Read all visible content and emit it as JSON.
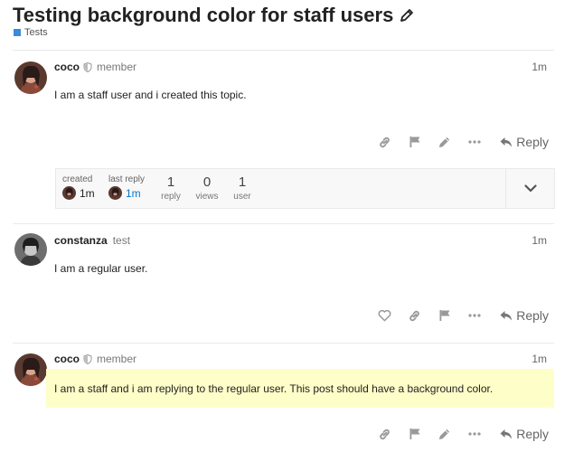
{
  "topic": {
    "title": "Testing background color for staff users",
    "category": "Tests",
    "category_color": "#3a8bd9"
  },
  "posts": [
    {
      "username": "coco",
      "user_title": "member",
      "is_staff": true,
      "date": "1m",
      "body": "I am a staff user and i created this topic.",
      "highlighted": false,
      "actions": [
        "link-icon",
        "flag-icon",
        "pencil-icon",
        "ellipsis-icon"
      ],
      "reply_label": "Reply"
    },
    {
      "username": "constanza",
      "user_title": "test",
      "is_staff": false,
      "date": "1m",
      "body": "I am a regular user.",
      "highlighted": false,
      "actions": [
        "heart-icon",
        "link-icon",
        "flag-icon",
        "ellipsis-icon"
      ],
      "reply_label": "Reply"
    },
    {
      "username": "coco",
      "user_title": "member",
      "is_staff": true,
      "date": "1m",
      "body": "I am a staff and i am replying to the regular user. This post should have a background color.",
      "highlighted": true,
      "highlight_color": "#fefec8",
      "actions": [
        "link-icon",
        "flag-icon",
        "pencil-icon",
        "ellipsis-icon"
      ],
      "reply_label": "Reply"
    }
  ],
  "topic_map": {
    "created_label": "created",
    "created_when": "1m",
    "last_reply_label": "last reply",
    "last_reply_when": "1m",
    "stats": [
      {
        "value": "1",
        "label": "reply"
      },
      {
        "value": "0",
        "label": "views"
      },
      {
        "value": "1",
        "label": "user"
      }
    ]
  }
}
